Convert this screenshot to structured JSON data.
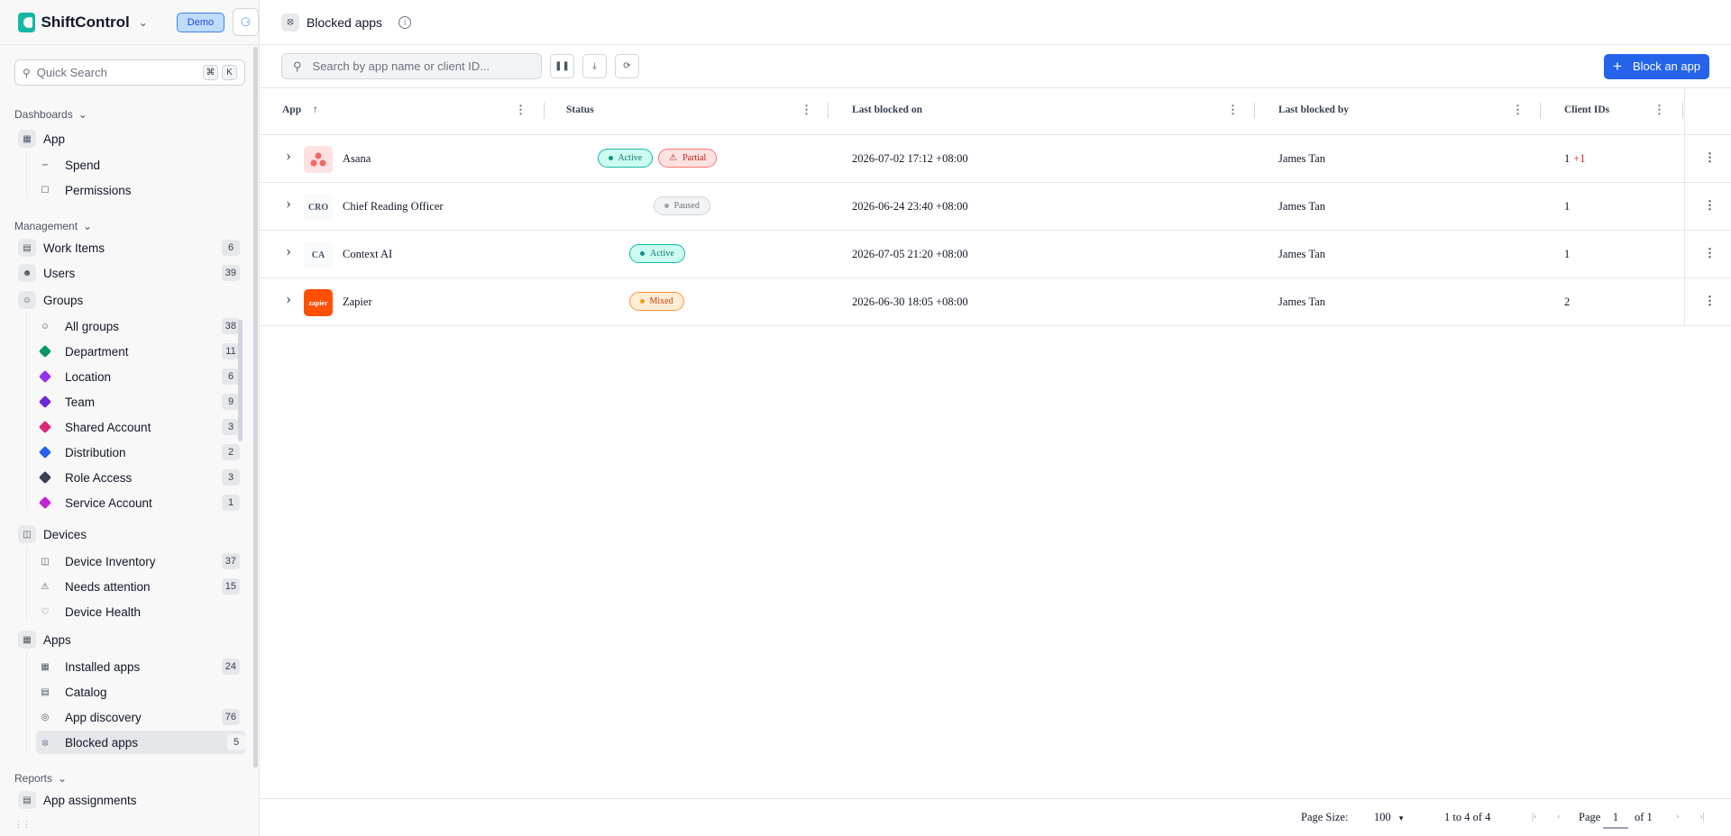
{
  "brand": {
    "name": "ShiftControl",
    "env_badge": "Demo"
  },
  "quick_search": {
    "placeholder": "Quick Search",
    "keys": [
      "⌘",
      "K"
    ]
  },
  "sidebar": {
    "dashboards_label": "Dashboards",
    "management_label": "Management",
    "reports_label": "Reports",
    "app": "App",
    "spend": "Spend",
    "permissions": "Permissions",
    "work_items": {
      "label": "Work Items",
      "count": "6"
    },
    "users": {
      "label": "Users",
      "count": "39"
    },
    "groups": "Groups",
    "group_items": [
      {
        "label": "All groups",
        "count": "38",
        "color": "#4b5563"
      },
      {
        "label": "Department",
        "count": "11",
        "color": "#059669"
      },
      {
        "label": "Location",
        "count": "6",
        "color": "#9333ea"
      },
      {
        "label": "Team",
        "count": "9",
        "color": "#6d28d9"
      },
      {
        "label": "Shared Account",
        "count": "3",
        "color": "#db2777"
      },
      {
        "label": "Distribution",
        "count": "2",
        "color": "#2563eb"
      },
      {
        "label": "Role Access",
        "count": "3",
        "color": "#374151"
      },
      {
        "label": "Service Account",
        "count": "1",
        "color": "#c026d3"
      }
    ],
    "devices": "Devices",
    "device_items": [
      {
        "label": "Device Inventory",
        "count": "37"
      },
      {
        "label": "Needs attention",
        "count": "15"
      },
      {
        "label": "Device Health",
        "count": ""
      }
    ],
    "apps": "Apps",
    "app_items": [
      {
        "label": "Installed apps",
        "count": "24"
      },
      {
        "label": "Catalog",
        "count": ""
      },
      {
        "label": "App discovery",
        "count": "76"
      },
      {
        "label": "Blocked apps",
        "count": "5"
      }
    ],
    "app_assignments": "App assignments"
  },
  "page": {
    "title": "Blocked apps"
  },
  "toolbar": {
    "search_placeholder": "Search by app name or client ID...",
    "block_button": "Block an app"
  },
  "columns": [
    "App",
    "Status",
    "Last blocked on",
    "Last blocked by",
    "Client IDs"
  ],
  "rows": [
    {
      "name": "Asana",
      "logo": "",
      "statuses": [
        {
          "label": "Active",
          "kind": "active"
        },
        {
          "label": "Partial",
          "kind": "partial"
        }
      ],
      "last_blocked_on": "2026-07-02 17:12 +08:00",
      "last_blocked_by": "James Tan",
      "client_ids": "1",
      "client_ids_extra": "+1"
    },
    {
      "name": "Chief Reading Officer",
      "logo": "CRO",
      "statuses": [
        {
          "label": "Paused",
          "kind": "paused"
        }
      ],
      "last_blocked_on": "2026-06-24 23:40 +08:00",
      "last_blocked_by": "James Tan",
      "client_ids": "1",
      "client_ids_extra": ""
    },
    {
      "name": "Context AI",
      "logo": "CA",
      "statuses": [
        {
          "label": "Active",
          "kind": "active"
        }
      ],
      "last_blocked_on": "2026-07-05 21:20 +08:00",
      "last_blocked_by": "James Tan",
      "client_ids": "1",
      "client_ids_extra": ""
    },
    {
      "name": "Zapier",
      "logo": "zapier",
      "statuses": [
        {
          "label": "Mixed",
          "kind": "mixed"
        }
      ],
      "last_blocked_on": "2026-06-30 18:05 +08:00",
      "last_blocked_by": "James Tan",
      "client_ids": "2",
      "client_ids_extra": ""
    }
  ],
  "footer": {
    "page_size_label": "Page Size:",
    "page_size": "100",
    "range": "1 to 4 of 4",
    "page_label": "Page",
    "page": "1",
    "of_label": "of 1"
  }
}
